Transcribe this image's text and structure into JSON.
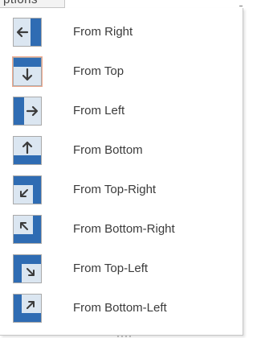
{
  "tab": {
    "label": "ptions"
  },
  "menu": {
    "items": [
      {
        "label": "From Right",
        "icon": "from-right-icon",
        "selected": false
      },
      {
        "label": "From Top",
        "icon": "from-top-icon",
        "selected": true
      },
      {
        "label": "From Left",
        "icon": "from-left-icon",
        "selected": false
      },
      {
        "label": "From Bottom",
        "icon": "from-bottom-icon",
        "selected": false
      },
      {
        "label": "From Top-Right",
        "icon": "from-top-right-icon",
        "selected": false
      },
      {
        "label": "From Bottom-Right",
        "icon": "from-bottom-right-icon",
        "selected": false
      },
      {
        "label": "From Top-Left",
        "icon": "from-top-left-icon",
        "selected": false
      },
      {
        "label": "From Bottom-Left",
        "icon": "from-bottom-left-icon",
        "selected": false
      }
    ]
  },
  "colors": {
    "accent": "#2f6cb3",
    "light_panel": "#dbe6f1",
    "arrow": "#3b3b3b",
    "selection_border": "#f0a98e"
  }
}
